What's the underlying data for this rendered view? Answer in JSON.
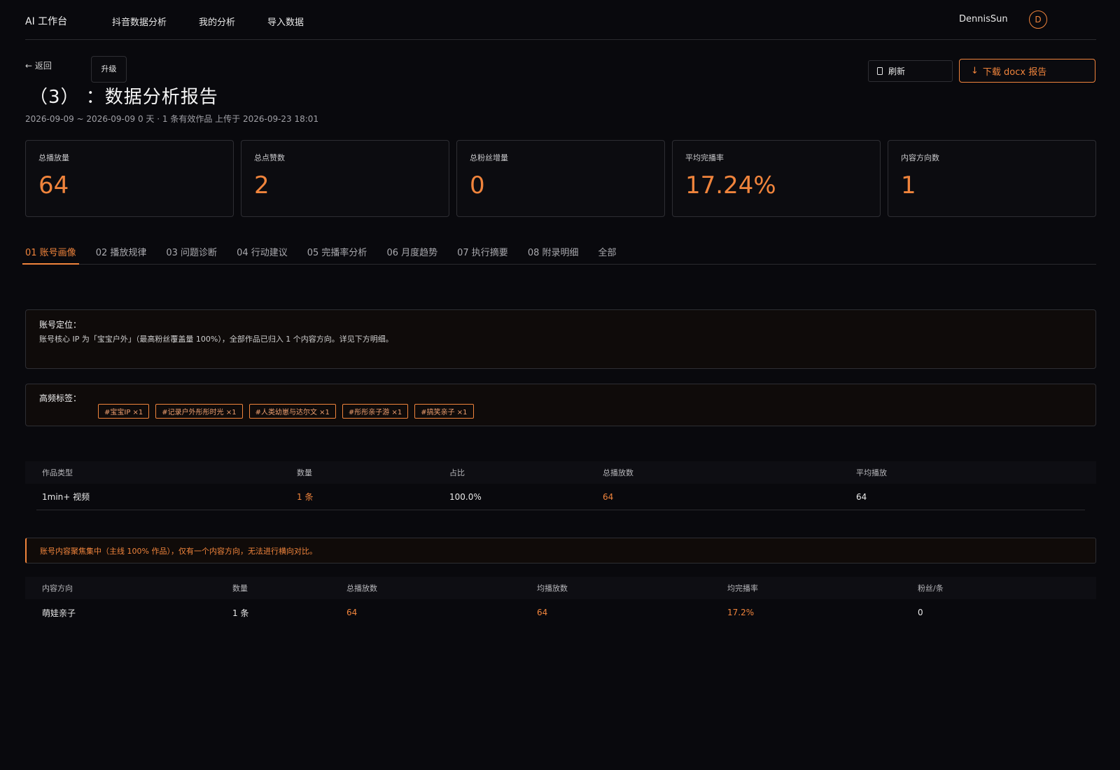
{
  "header": {
    "brand": "AI 工作台",
    "nav": [
      "抖音数据分析",
      "我的分析",
      "导入数据"
    ],
    "user_name": "DennisSun",
    "avatar_initial": "D"
  },
  "page": {
    "back_label": "← 返回",
    "upgrade_label": "升级",
    "title": "（3） ：数据分析报告",
    "meta": "2026-09-09 ~ 2026-09-09   0 天 ·   1 条有效作品   上传于 2026-09-23 18:01",
    "refresh_label": "刷新",
    "download_label": "下载 docx 报告"
  },
  "stats": [
    {
      "label": "总播放量",
      "value": "64"
    },
    {
      "label": "总点赞数",
      "value": "2"
    },
    {
      "label": "总粉丝增量",
      "value": "0"
    },
    {
      "label": "平均完播率",
      "value": "17.24%"
    },
    {
      "label": "内容方向数",
      "value": "1"
    }
  ],
  "tabs": [
    "01 账号画像",
    "02 播放规律",
    "03 问题诊断",
    "04 行动建议",
    "05 完播率分析",
    "06 月度趋势",
    "07 执行摘要",
    "08 附录明细",
    "全部"
  ],
  "positioning": {
    "title": "账号定位：",
    "body": "账号核心 IP 为「宝宝户外」（最高粉丝覆盖量 100%），全部作品已归入 1 个内容方向。详见下方明细。"
  },
  "tags_panel": {
    "title": "高频标签：",
    "tags": [
      "#宝宝IP ×1",
      "#记录户外彤彤时光 ×1",
      "#人类幼崽与达尔文 ×1",
      "#彤彤亲子游 ×1",
      "#搞笑亲子 ×1"
    ]
  },
  "type_table": {
    "headers": [
      "作品类型",
      "数量",
      "占比",
      "总播放数",
      "平均播放"
    ],
    "rows": [
      [
        "1min+ 视频",
        "1 条",
        "100.0%",
        "64",
        "64"
      ]
    ]
  },
  "alert": "账号内容聚焦集中（主线 100% 作品），仅有一个内容方向，无法进行横向对比。",
  "direction_table": {
    "headers": [
      "内容方向",
      "数量",
      "总播放数",
      "均播放数",
      "均完播率",
      "粉丝/条"
    ],
    "rows": [
      [
        "萌娃亲子",
        "1 条",
        "64",
        "64",
        "17.2%",
        "0"
      ]
    ]
  }
}
